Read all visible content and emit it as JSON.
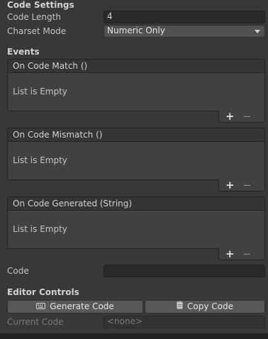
{
  "code_settings": {
    "title": "Code Settings",
    "code_length_label": "Code Length",
    "code_length_value": "4",
    "charset_mode_label": "Charset Mode",
    "charset_mode_value": "Numeric Only"
  },
  "events": {
    "title": "Events",
    "lists": [
      {
        "header": "On Code Match ()",
        "empty_text": "List is Empty",
        "add": "+",
        "remove": "−"
      },
      {
        "header": "On Code Mismatch ()",
        "empty_text": "List is Empty",
        "add": "+",
        "remove": "−"
      },
      {
        "header": "On Code Generated (String)",
        "empty_text": "List is Empty",
        "add": "+",
        "remove": "−"
      }
    ]
  },
  "code_field": {
    "label": "Code",
    "value": ""
  },
  "editor_controls": {
    "title": "Editor Controls",
    "generate_label": "Generate Code",
    "copy_label": "Copy Code",
    "current_code_label": "Current Code",
    "current_code_value": "<none>"
  },
  "icons": {
    "generate": "keyboard-icon",
    "copy": "clipboard-icon",
    "dropdown": "chevron-down-icon"
  }
}
